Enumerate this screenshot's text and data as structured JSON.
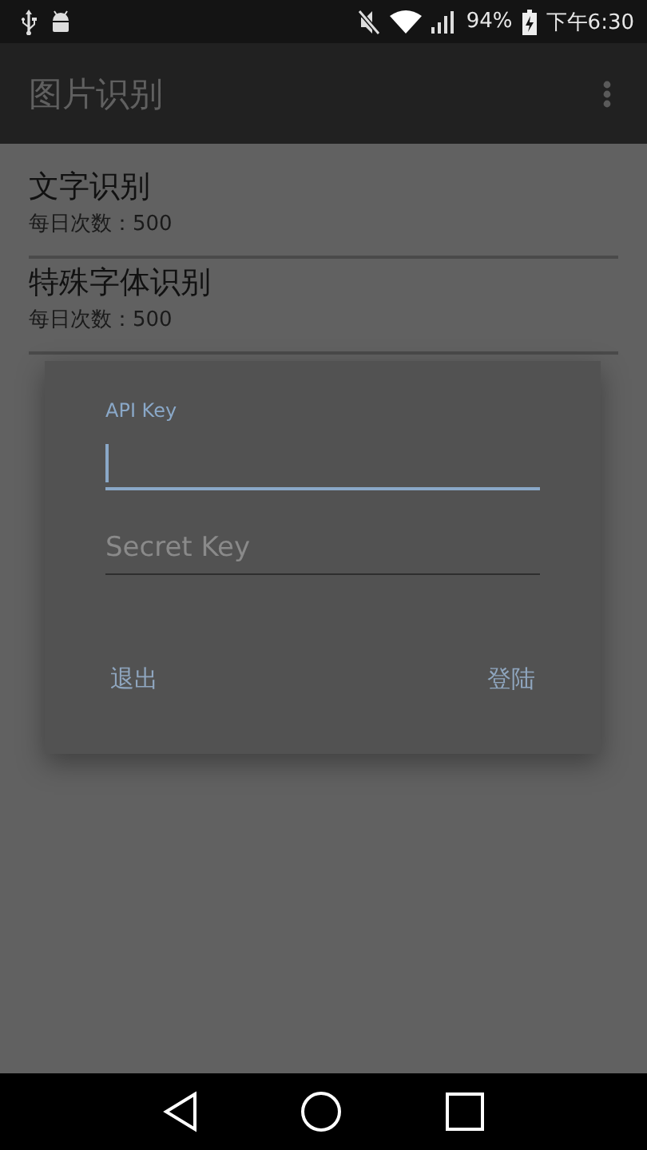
{
  "status_bar": {
    "battery": "94%",
    "time": "下午6:30"
  },
  "app_bar": {
    "title": "图片识别"
  },
  "list": [
    {
      "title": "文字识别",
      "subtitle": "每日次数：500"
    },
    {
      "title": "特殊字体识别",
      "subtitle": "每日次数：500"
    }
  ],
  "dialog": {
    "fields": [
      {
        "label": "API Key",
        "focused": true
      },
      {
        "placeholder": "Secret Key",
        "focused": false
      }
    ],
    "buttons": [
      "退出",
      "登陆"
    ]
  }
}
